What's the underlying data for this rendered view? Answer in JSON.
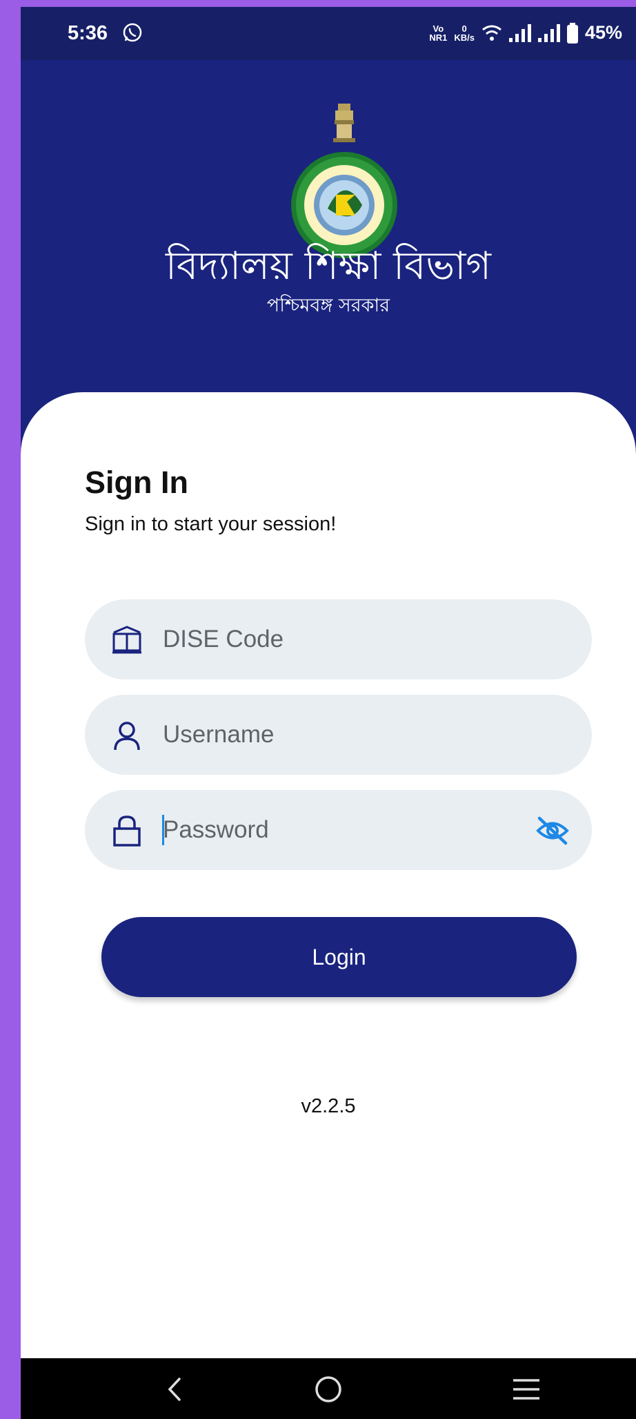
{
  "status_bar": {
    "time": "5:36",
    "network_top": "Vo",
    "network_bottom": "NR1",
    "speed_value": "0",
    "speed_unit": "KB/s",
    "battery": "45%"
  },
  "header": {
    "department": "বিদ্যালয় শিক্ষা বিভাগ",
    "government": "পশ্চিমবঙ্গ সরকার"
  },
  "signin": {
    "title": "Sign In",
    "subtitle": "Sign in to start your session!"
  },
  "form": {
    "dise_placeholder": "DISE Code",
    "username_placeholder": "Username",
    "password_placeholder": "Password",
    "login_label": "Login"
  },
  "footer": {
    "version": "v2.2.5"
  },
  "colors": {
    "primary": "#1a237e",
    "field_bg": "#e9eef2",
    "accent": "#1e88e5"
  }
}
